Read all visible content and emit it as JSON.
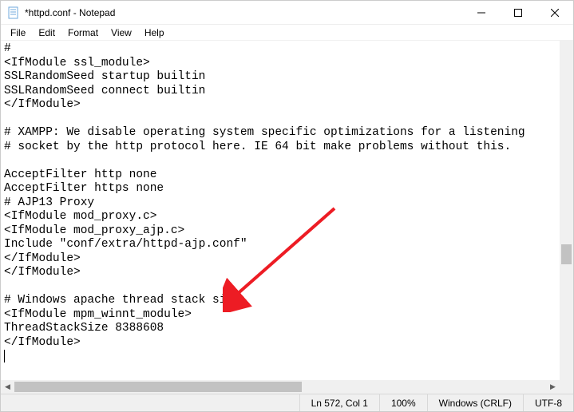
{
  "window": {
    "title": "*httpd.conf - Notepad"
  },
  "menu": {
    "file": "File",
    "edit": "Edit",
    "format": "Format",
    "view": "View",
    "help": "Help"
  },
  "editor": {
    "content": "#\n<IfModule ssl_module>\nSSLRandomSeed startup builtin\nSSLRandomSeed connect builtin\n</IfModule>\n\n# XAMPP: We disable operating system specific optimizations for a listening\n# socket by the http protocol here. IE 64 bit make problems without this.\n\nAcceptFilter http none\nAcceptFilter https none\n# AJP13 Proxy\n<IfModule mod_proxy.c>\n<IfModule mod_proxy_ajp.c>\nInclude \"conf/extra/httpd-ajp.conf\"\n</IfModule>\n</IfModule>\n\n# Windows apache thread stack size\n<IfModule mpm_winnt_module>\nThreadStackSize 8388608\n</IfModule>\n"
  },
  "status": {
    "position": "Ln 572, Col 1",
    "zoom": "100%",
    "line_ending": "Windows (CRLF)",
    "encoding": "UTF-8"
  },
  "annotation": {
    "color": "#ed1c24"
  }
}
